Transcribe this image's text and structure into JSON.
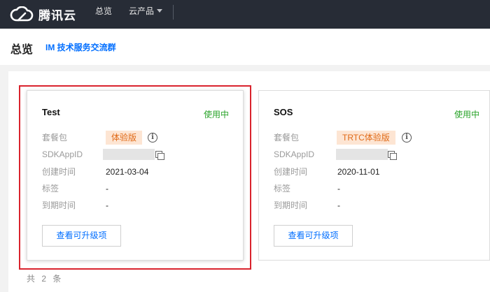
{
  "topbar": {
    "brand": "腾讯云",
    "nav": {
      "overview": "总览",
      "products": "云产品"
    }
  },
  "page": {
    "title": "总览",
    "link": "IM 技术服务交流群"
  },
  "labels": {
    "package": "套餐包",
    "sdkappid": "SDKAppID",
    "created": "创建时间",
    "tags": "标签",
    "expire": "到期时间",
    "upgrade": "查看可升级项"
  },
  "apps": [
    {
      "name": "Test",
      "status": "使用中",
      "package": "体验版",
      "created": "2021-03-04",
      "tags": "-",
      "expire": "-"
    },
    {
      "name": "SOS",
      "status": "使用中",
      "package": "TRTC体验版",
      "created": "2020-11-01",
      "tags": "-",
      "expire": "-"
    }
  ],
  "footer": {
    "total": "共 2 条"
  },
  "colors": {
    "topbar": "#272c36",
    "accent": "#006eff",
    "status": "#29a329",
    "tag_bg": "#fde5d3",
    "tag_text": "#e06a17",
    "highlight": "#d9232d"
  }
}
